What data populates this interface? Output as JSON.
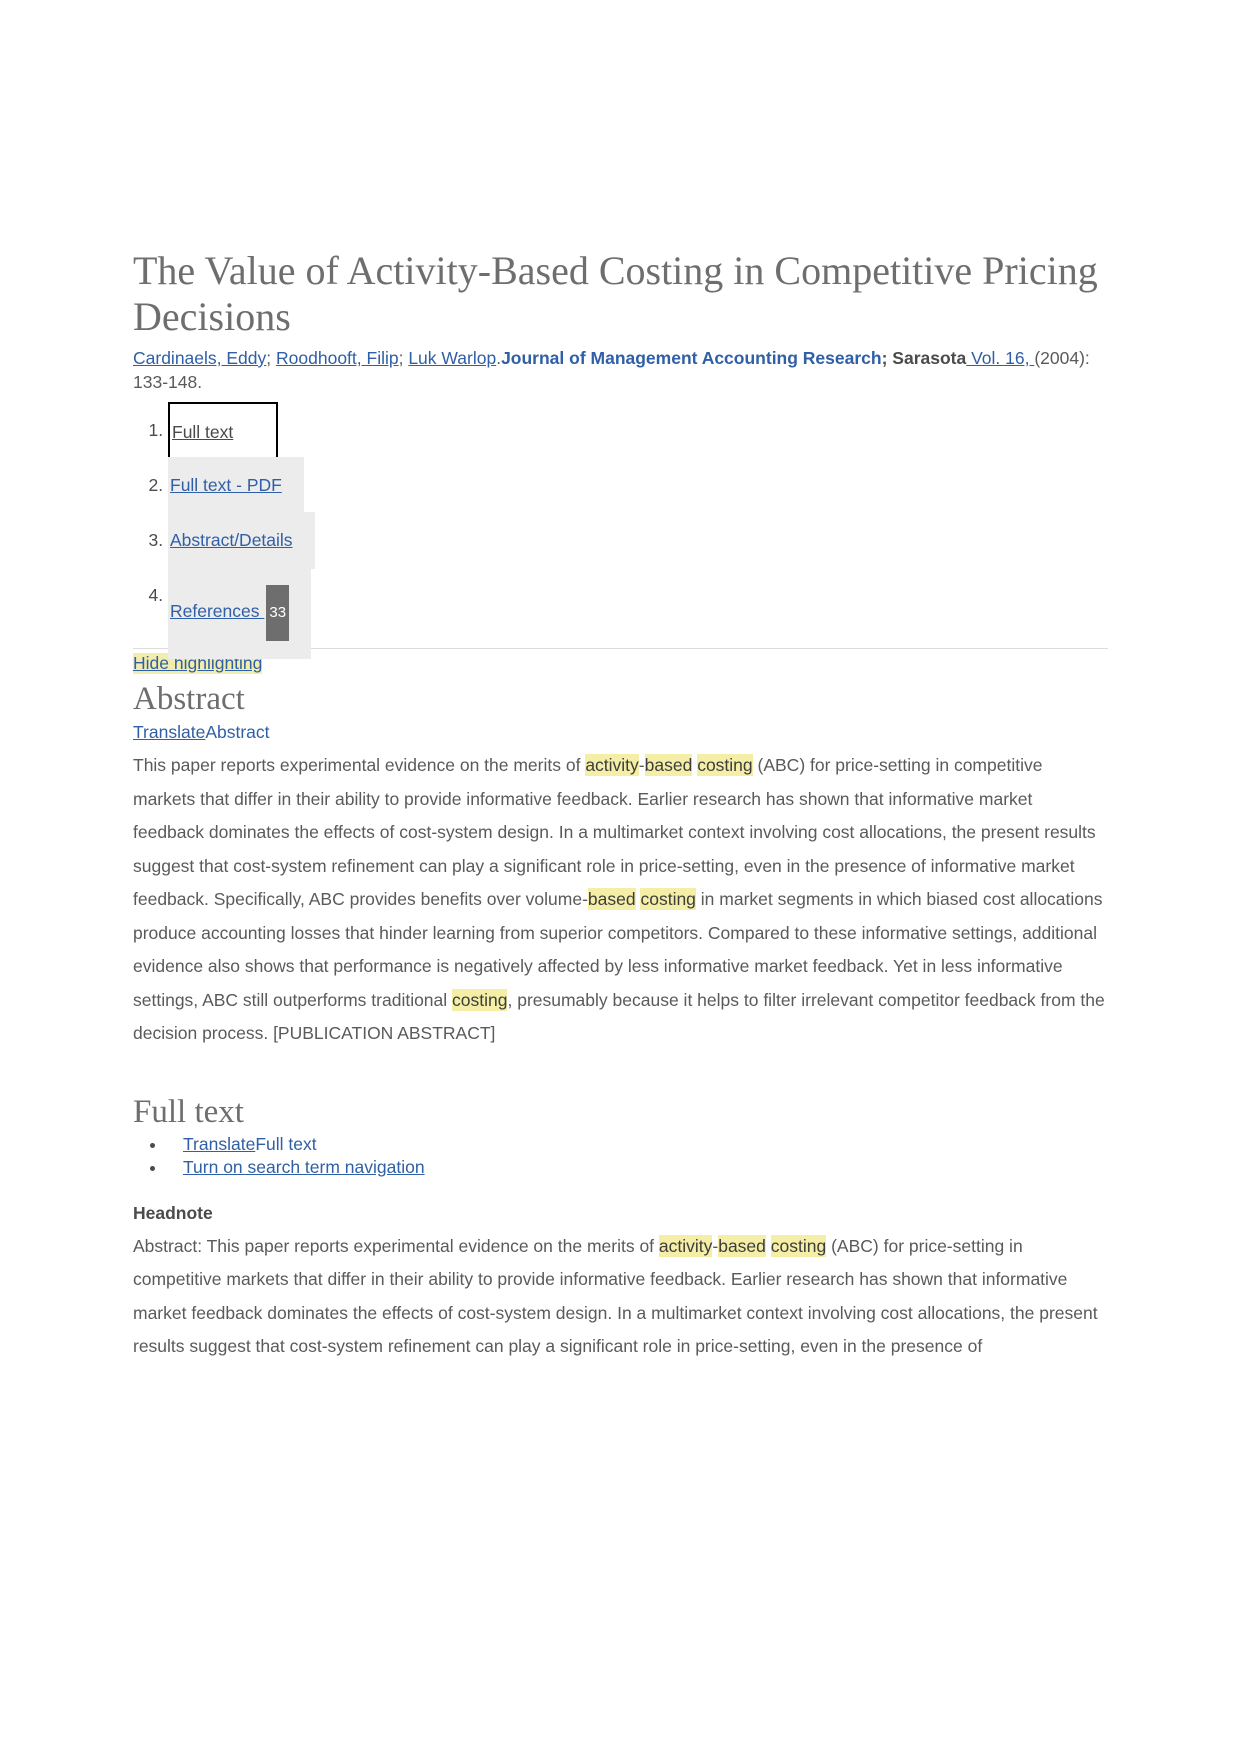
{
  "document": {
    "title": "The Value of Activity-Based Costing in Competitive Pricing Decisions",
    "authors": [
      {
        "name": "Cardinaels, Eddy"
      },
      {
        "name": "Roodhooft, Filip"
      },
      {
        "name": "Luk Warlop"
      }
    ],
    "author_separator": "; ",
    "author_terminator": ".",
    "journal_name": "Journal of Management Accounting Research",
    "publication_place": "; Sarasota",
    "volume_link": " Vol. 16, ",
    "citation_rest": " (2004): 133-148."
  },
  "doc_links": [
    {
      "label": "Full text",
      "state": "active",
      "badge": ""
    },
    {
      "label": "Full text - PDF",
      "state": "inactive",
      "badge": ""
    },
    {
      "label": "Abstract/Details",
      "state": "inactive",
      "badge": ""
    },
    {
      "label": "References ",
      "state": "inactive",
      "badge": "33"
    }
  ],
  "toolbar": {
    "hide_highlighting": "Hide highlighting"
  },
  "abstract": {
    "heading": "Abstract",
    "translate_link": "Translate",
    "translate_suffix": "Abstract",
    "paragraph_parts": [
      {
        "t": "This paper reports experimental evidence on the merits of ",
        "hl": false
      },
      {
        "t": "activity",
        "hl": true
      },
      {
        "t": "-",
        "hl": false
      },
      {
        "t": "based",
        "hl": true
      },
      {
        "t": " ",
        "hl": false
      },
      {
        "t": "costing",
        "hl": true
      },
      {
        "t": " (ABC) for price-setting in competitive markets that differ in their ability to provide informative feedback. Earlier research has shown that informative market feedback dominates the effects of cost-system design. In a multimarket context involving cost allocations, the present results suggest that cost-system refinement can play a significant role in price-setting, even in the presence of informative market feedback. Specifically, ABC provides benefits over volume-",
        "hl": false
      },
      {
        "t": "based",
        "hl": true
      },
      {
        "t": " ",
        "hl": false
      },
      {
        "t": "costing",
        "hl": true
      },
      {
        "t": " in market segments in which biased cost allocations produce accounting losses that hinder learning from superior competitors. Compared to these informative settings, additional evidence also shows that performance is negatively affected by less informative market feedback. Yet in less informative settings, ABC still outperforms traditional ",
        "hl": false
      },
      {
        "t": "costing",
        "hl": true
      },
      {
        "t": ", presumably because it helps to filter irrelevant competitor feedback from the decision process. [PUBLICATION ABSTRACT]",
        "hl": false
      }
    ]
  },
  "full_text": {
    "heading": "Full text",
    "links": [
      {
        "link_text": "Translate",
        "suffix": "Full text"
      },
      {
        "link_text": "Turn on search term navigation",
        "suffix": ""
      }
    ],
    "headnote_label": "Headnote",
    "paragraph_parts": [
      {
        "t": "Abstract: This paper reports experimental evidence on the merits of ",
        "hl": false
      },
      {
        "t": "activity",
        "hl": true
      },
      {
        "t": "-",
        "hl": false
      },
      {
        "t": "based",
        "hl": true
      },
      {
        "t": " ",
        "hl": false
      },
      {
        "t": "costing",
        "hl": true
      },
      {
        "t": " (ABC) for price-setting in competitive markets that differ in their ability to provide informative feedback. Earlier research has shown that informative market feedback dominates the effects of cost-system design. In a multimarket context involving cost allocations, the present results suggest that cost-system refinement can play a significant role in price-setting, even in the presence of",
        "hl": false
      }
    ]
  },
  "colors": {
    "link": "#2f5fa6",
    "highlight": "#f4eea6",
    "heading": "#6e6e6e",
    "body_text": "#5a5a5a",
    "badge_bg": "#6e6e6e",
    "tab_inactive_bg": "#ececec"
  }
}
